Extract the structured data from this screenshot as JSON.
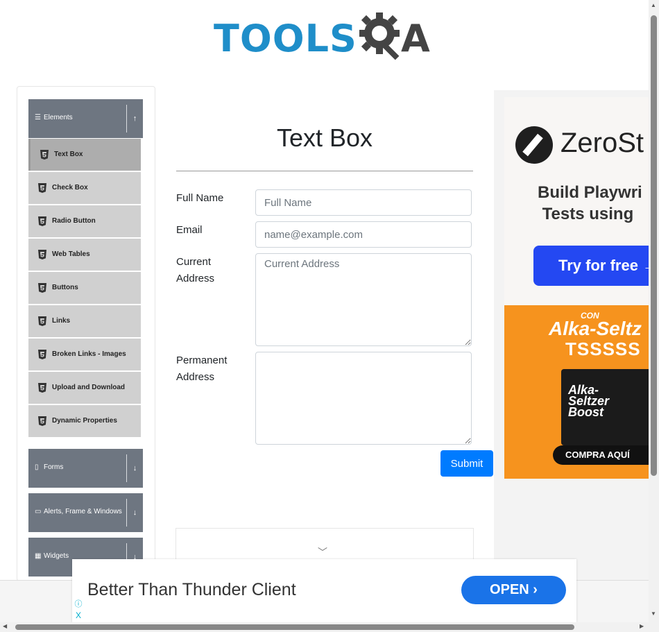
{
  "header": {
    "logo_tools": "TOOLS",
    "logo_a": "A"
  },
  "sidebar": {
    "elements_group": {
      "label": "Elements",
      "icon": "hamburger-icon",
      "arrow": "↑"
    },
    "items": [
      {
        "label": "Text Box",
        "active": true
      },
      {
        "label": "Check Box"
      },
      {
        "label": "Radio Button"
      },
      {
        "label": "Web Tables"
      },
      {
        "label": "Buttons"
      },
      {
        "label": "Links"
      },
      {
        "label": "Broken Links - Images"
      },
      {
        "label": "Upload and Download"
      },
      {
        "label": "Dynamic Properties"
      }
    ],
    "groups": [
      {
        "label": "Forms",
        "icon": "document-icon",
        "arrow": "↓"
      },
      {
        "label": "Alerts, Frame & Windows",
        "icon": "window-icon",
        "arrow": "↓"
      },
      {
        "label": "Widgets",
        "icon": "grid-icon",
        "arrow": "↓"
      }
    ]
  },
  "main": {
    "title": "Text Box",
    "form": {
      "full_name_label": "Full Name",
      "full_name_placeholder": "Full Name",
      "email_label": "Email",
      "email_placeholder": "name@example.com",
      "current_address_label": "Current Address",
      "current_address_placeholder": "Current Address",
      "permanent_address_label": "Permanent Address",
      "submit_label": "Submit"
    }
  },
  "ads": {
    "zerostep": {
      "name": "ZeroSt",
      "tagline": "Build Playwri\n Tests using",
      "cta": "Try for free →"
    },
    "alka": {
      "con": "CON",
      "brand": "Alka-Seltz",
      "sound": "TSSSSS",
      "box_label": "Alka-\nSeltzer\nBoost",
      "cta": "COMPRA AQUÍ"
    },
    "bottom": {
      "text": "Better Than Thunder Client",
      "open_label": "OPEN ›",
      "info": "ⓘ",
      "close": "X"
    }
  },
  "colors": {
    "accent": "#007bff",
    "sidebar_header": "#6e7681",
    "logo_blue": "#1f8ec9"
  }
}
